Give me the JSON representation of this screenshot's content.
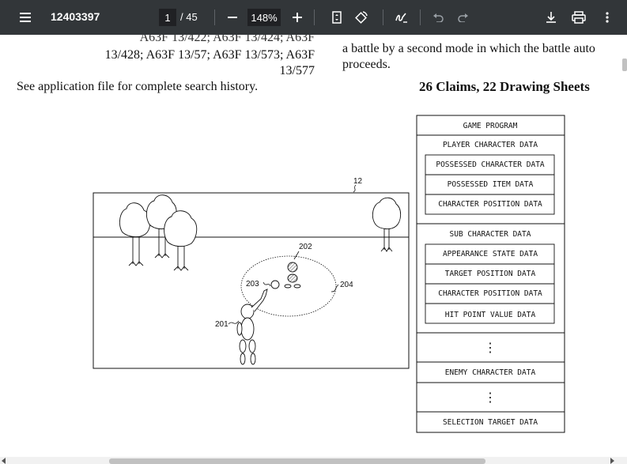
{
  "toolbar": {
    "doc_title": "12403397",
    "current_page": "1",
    "page_total": "/ 45",
    "zoom": "148%",
    "icons": [
      "menu-icon",
      "zoom-out-icon",
      "zoom-in-icon",
      "fit-page-icon",
      "rotate-icon",
      "draw-icon",
      "undo-icon",
      "redo-icon",
      "download-icon",
      "print-icon",
      "more-icon"
    ]
  },
  "left_column": {
    "cut_line": "A63F 13/422; A63F 13/424; A63F",
    "line1": "13/428; A63F 13/57; A63F 13/573; A63F",
    "line2": "13/577",
    "search_history": "See application file for complete search history."
  },
  "right_column": {
    "line1": "a battle by a second mode in which the battle auto",
    "line2": "proceeds.",
    "claims": "26 Claims, 22 Drawing Sheets"
  },
  "figure": {
    "ref_screen": "12",
    "ref_sub": "202",
    "ref_area": "204",
    "ref_item": "203",
    "ref_player": "201"
  },
  "data_table": {
    "game_program": "GAME PROGRAM",
    "player_character_data": "PLAYER CHARACTER DATA",
    "player_items": [
      "POSSESSED CHARACTER DATA",
      "POSSESSED ITEM DATA",
      "CHARACTER POSITION DATA"
    ],
    "sub_character_data": "SUB CHARACTER DATA",
    "sub_items": [
      "APPEARANCE STATE DATA",
      "TARGET POSITION DATA",
      "CHARACTER POSITION DATA",
      "HIT POINT VALUE DATA"
    ],
    "ellipsis": "⋮",
    "enemy_character_data": "ENEMY CHARACTER DATA",
    "selection_target_data": "SELECTION TARGET DATA"
  }
}
